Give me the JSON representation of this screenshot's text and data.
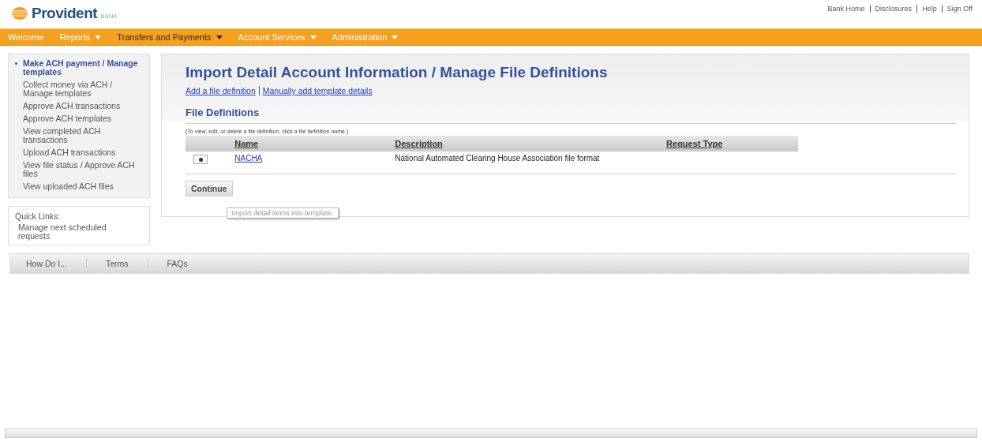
{
  "logo": {
    "name": "Provident",
    "suffix": "BANK"
  },
  "top_links": [
    "Bank Home",
    "Disclosures",
    "Help",
    "Sign Off"
  ],
  "nav": [
    {
      "label": "Welcome",
      "dropdown": false,
      "selected": false
    },
    {
      "label": "Reports",
      "dropdown": true,
      "selected": false
    },
    {
      "label": "Transfers and Payments",
      "dropdown": true,
      "selected": true
    },
    {
      "label": "Account Services",
      "dropdown": true,
      "selected": false
    },
    {
      "label": "Administration",
      "dropdown": true,
      "selected": false
    }
  ],
  "sidebar": {
    "items": [
      {
        "label": "Make ACH payment / Manage templates",
        "selected": true
      },
      {
        "label": "Collect money via ACH / Manage templates",
        "selected": false
      },
      {
        "label": "Approve ACH transactions",
        "selected": false
      },
      {
        "label": "Approve ACH templates",
        "selected": false
      },
      {
        "label": "View completed ACH transactions",
        "selected": false
      },
      {
        "label": "Upload ACH transactions",
        "selected": false
      },
      {
        "label": "View file status / Approve ACH files",
        "selected": false
      },
      {
        "label": "View uploaded ACH files",
        "selected": false
      }
    ]
  },
  "quick_links": {
    "title": "Quick Links:",
    "items": [
      "Manage next scheduled requests"
    ]
  },
  "main": {
    "title": "Import Detail Account Information / Manage File Definitions",
    "links": [
      "Add a file definition",
      "Manually add template details"
    ],
    "section_title": "File Definitions",
    "hint": "(To view, edit, or delete a file definition, click a file definition name.)",
    "table": {
      "columns": [
        "Name",
        "Description",
        "Request Type"
      ],
      "rows": [
        {
          "selected": true,
          "name": "NACHA",
          "description": "National Automated Clearing House Association file format"
        }
      ]
    },
    "button": "Continue",
    "tooltip": "Import detail items into template."
  },
  "footer": [
    "How Do I...",
    "Terms",
    "FAQs"
  ]
}
